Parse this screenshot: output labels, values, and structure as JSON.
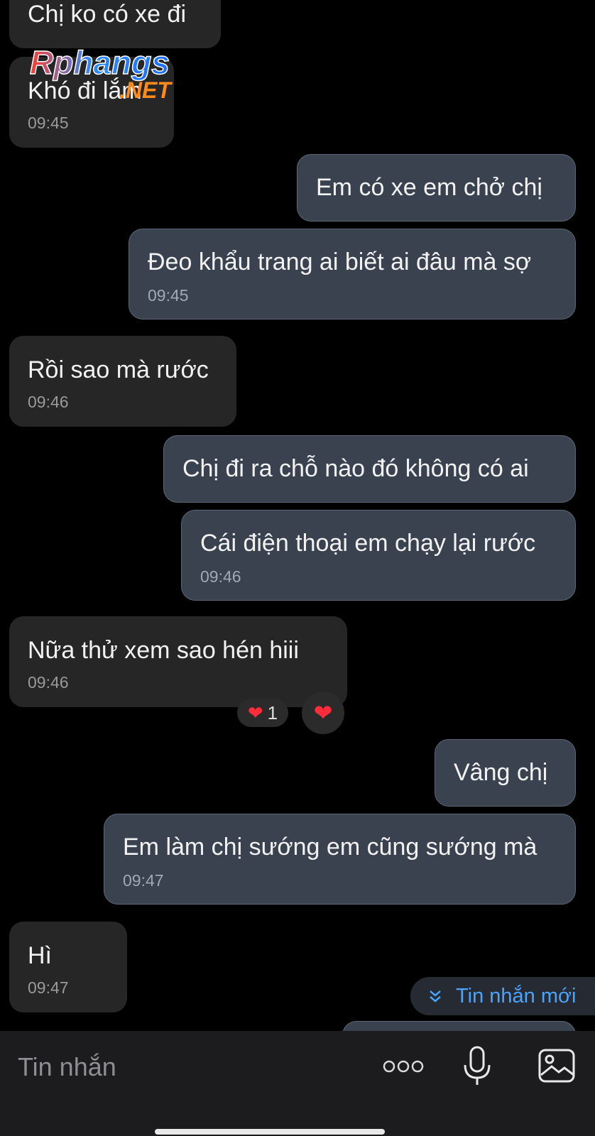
{
  "messages": [
    {
      "dir": "in",
      "text": "Chị ko có xe đi",
      "time": ""
    },
    {
      "dir": "in",
      "text": "Khó đi lắm",
      "time": "09:45"
    },
    {
      "dir": "out",
      "text": "Em có xe em chở chị",
      "time": ""
    },
    {
      "dir": "out",
      "text": "Đeo khẩu trang ai biết ai đâu mà sợ",
      "time": "09:45"
    },
    {
      "dir": "in",
      "text": "Rồi sao mà rước",
      "time": "09:46"
    },
    {
      "dir": "out",
      "text": "Chị đi ra chỗ nào đó không có ai",
      "time": ""
    },
    {
      "dir": "out",
      "text": "Cái điện thoại em chạy lại rước",
      "time": "09:46"
    },
    {
      "dir": "in",
      "text": "Nữa thử xem sao hén    hiii",
      "time": "09:46"
    },
    {
      "dir": "out",
      "text": "Vâng chị",
      "time": ""
    },
    {
      "dir": "out",
      "text": "Em làm chị sướng em cũng sướng mà",
      "time": "09:47"
    },
    {
      "dir": "in",
      "text": "Hì",
      "time": "09:47"
    }
  ],
  "reactions": {
    "heart_count": "1",
    "heart_glyph": "❤",
    "accent": "#ff2d3b"
  },
  "new_message_pill": {
    "label": "Tin nhắn mới",
    "icon": "double-chevron-down-icon",
    "color": "#4aa3ff"
  },
  "composer": {
    "placeholder": "Tin nhắn",
    "icons": [
      "more-icon",
      "microphone-icon",
      "image-icon"
    ]
  },
  "watermark": {
    "brand": "Rphangs",
    "suffix": ".NET"
  }
}
